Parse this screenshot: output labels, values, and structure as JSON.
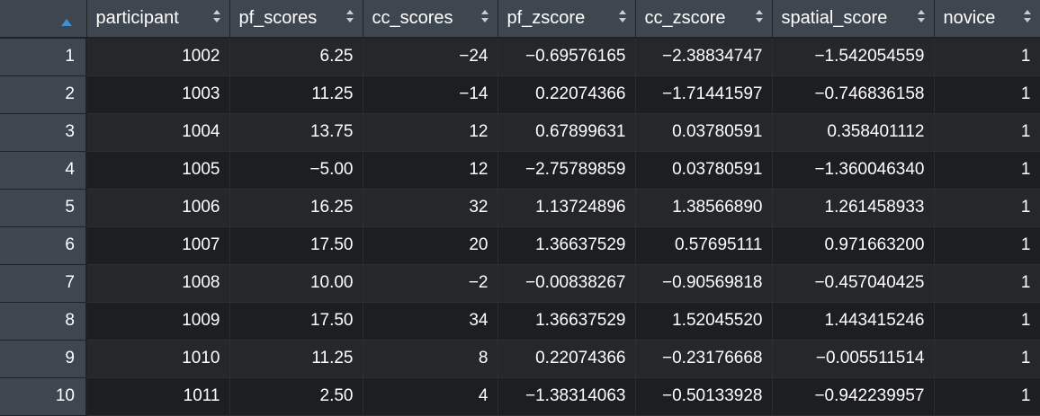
{
  "table": {
    "columns": [
      {
        "key": "participant",
        "label": "participant"
      },
      {
        "key": "pf_scores",
        "label": "pf_scores"
      },
      {
        "key": "cc_scores",
        "label": "cc_scores"
      },
      {
        "key": "pf_zscore",
        "label": "pf_zscore"
      },
      {
        "key": "cc_zscore",
        "label": "cc_zscore"
      },
      {
        "key": "spatial_score",
        "label": "spatial_score"
      },
      {
        "key": "novice",
        "label": "novice"
      }
    ],
    "sorted_column_indicator": "sort-ascending-icon",
    "rows": [
      {
        "n": "1",
        "cells": [
          "1002",
          "6.25",
          "−24",
          "−0.69576165",
          "−2.38834747",
          "−1.542054559",
          "1"
        ]
      },
      {
        "n": "2",
        "cells": [
          "1003",
          "11.25",
          "−14",
          "0.22074366",
          "−1.71441597",
          "−0.746836158",
          "1"
        ]
      },
      {
        "n": "3",
        "cells": [
          "1004",
          "13.75",
          "12",
          "0.67899631",
          "0.03780591",
          "0.358401112",
          "1"
        ]
      },
      {
        "n": "4",
        "cells": [
          "1005",
          "−5.00",
          "12",
          "−2.75789859",
          "0.03780591",
          "−1.360046340",
          "1"
        ]
      },
      {
        "n": "5",
        "cells": [
          "1006",
          "16.25",
          "32",
          "1.13724896",
          "1.38566890",
          "1.261458933",
          "1"
        ]
      },
      {
        "n": "6",
        "cells": [
          "1007",
          "17.50",
          "20",
          "1.36637529",
          "0.57695111",
          "0.971663200",
          "1"
        ]
      },
      {
        "n": "7",
        "cells": [
          "1008",
          "10.00",
          "−2",
          "−0.00838267",
          "−0.90569818",
          "−0.457040425",
          "1"
        ]
      },
      {
        "n": "8",
        "cells": [
          "1009",
          "17.50",
          "34",
          "1.36637529",
          "1.52045520",
          "1.443415246",
          "1"
        ]
      },
      {
        "n": "9",
        "cells": [
          "1010",
          "11.25",
          "8",
          "0.22074366",
          "−0.23176668",
          "−0.005511514",
          "1"
        ]
      },
      {
        "n": "10",
        "cells": [
          "1011",
          "2.50",
          "4",
          "−1.38314063",
          "−0.50133928",
          "−0.942239957",
          "1"
        ]
      }
    ]
  },
  "colors": {
    "header_bg": "#3e4650",
    "row_odd": "#25272a",
    "row_even": "#1c1e21",
    "text": "#ffffff",
    "sort_active": "#3d8fd6"
  }
}
